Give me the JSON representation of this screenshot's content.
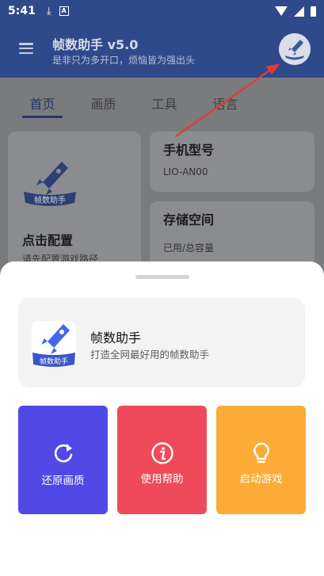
{
  "status_bar": {
    "time": "5:41",
    "download_icon": "download-arrow-icon",
    "notification_icon": "A"
  },
  "app_bar": {
    "title": "帧数助手 v5.0",
    "subtitle": "是非只为多开口，烦恼皆为强出头"
  },
  "tabs": [
    {
      "label": "首页",
      "active": true
    },
    {
      "label": "画质",
      "active": false
    },
    {
      "label": "工具",
      "active": false
    },
    {
      "label": "语言",
      "active": false
    }
  ],
  "cards": {
    "config": {
      "title": "点击配置",
      "subtitle": "请先配置游戏路径"
    },
    "phone": {
      "title": "手机型号",
      "value": "LIO-AN00"
    },
    "storage": {
      "title": "存储空间",
      "value": "已用/总容量"
    }
  },
  "sheet": {
    "app_name": "帧数助手",
    "app_desc": "打造全网最好用的帧数助手",
    "actions": [
      {
        "label": "还原画质",
        "icon": "refresh-icon",
        "color": "#5049e6"
      },
      {
        "label": "使用帮助",
        "icon": "info-icon",
        "color": "#ef4a5a"
      },
      {
        "label": "启动游戏",
        "icon": "lightbulb-icon",
        "color": "#fbab36"
      }
    ]
  },
  "logo_text": "帧数助手",
  "colors": {
    "app_bar": "#2f4a8a",
    "annotation_arrow": "#e53935"
  }
}
